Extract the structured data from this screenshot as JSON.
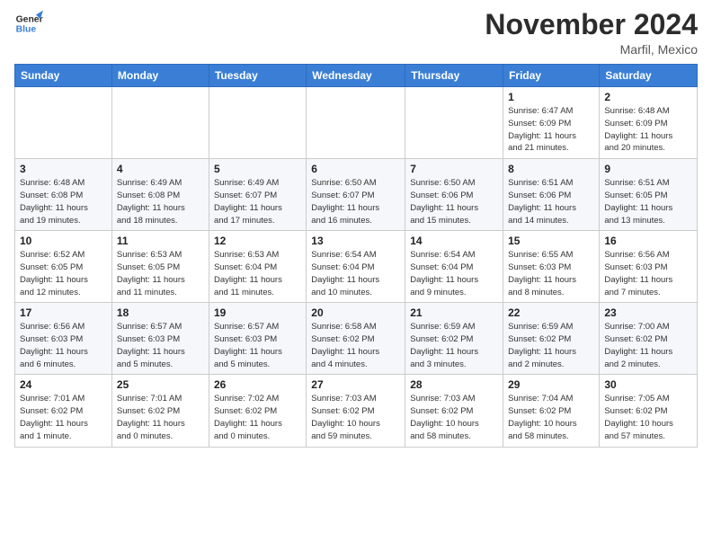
{
  "logo": {
    "line1": "General",
    "line2": "Blue"
  },
  "title": "November 2024",
  "location": "Marfil, Mexico",
  "days_of_week": [
    "Sunday",
    "Monday",
    "Tuesday",
    "Wednesday",
    "Thursday",
    "Friday",
    "Saturday"
  ],
  "weeks": [
    [
      {
        "day": "",
        "info": ""
      },
      {
        "day": "",
        "info": ""
      },
      {
        "day": "",
        "info": ""
      },
      {
        "day": "",
        "info": ""
      },
      {
        "day": "",
        "info": ""
      },
      {
        "day": "1",
        "info": "Sunrise: 6:47 AM\nSunset: 6:09 PM\nDaylight: 11 hours\nand 21 minutes."
      },
      {
        "day": "2",
        "info": "Sunrise: 6:48 AM\nSunset: 6:09 PM\nDaylight: 11 hours\nand 20 minutes."
      }
    ],
    [
      {
        "day": "3",
        "info": "Sunrise: 6:48 AM\nSunset: 6:08 PM\nDaylight: 11 hours\nand 19 minutes."
      },
      {
        "day": "4",
        "info": "Sunrise: 6:49 AM\nSunset: 6:08 PM\nDaylight: 11 hours\nand 18 minutes."
      },
      {
        "day": "5",
        "info": "Sunrise: 6:49 AM\nSunset: 6:07 PM\nDaylight: 11 hours\nand 17 minutes."
      },
      {
        "day": "6",
        "info": "Sunrise: 6:50 AM\nSunset: 6:07 PM\nDaylight: 11 hours\nand 16 minutes."
      },
      {
        "day": "7",
        "info": "Sunrise: 6:50 AM\nSunset: 6:06 PM\nDaylight: 11 hours\nand 15 minutes."
      },
      {
        "day": "8",
        "info": "Sunrise: 6:51 AM\nSunset: 6:06 PM\nDaylight: 11 hours\nand 14 minutes."
      },
      {
        "day": "9",
        "info": "Sunrise: 6:51 AM\nSunset: 6:05 PM\nDaylight: 11 hours\nand 13 minutes."
      }
    ],
    [
      {
        "day": "10",
        "info": "Sunrise: 6:52 AM\nSunset: 6:05 PM\nDaylight: 11 hours\nand 12 minutes."
      },
      {
        "day": "11",
        "info": "Sunrise: 6:53 AM\nSunset: 6:05 PM\nDaylight: 11 hours\nand 11 minutes."
      },
      {
        "day": "12",
        "info": "Sunrise: 6:53 AM\nSunset: 6:04 PM\nDaylight: 11 hours\nand 11 minutes."
      },
      {
        "day": "13",
        "info": "Sunrise: 6:54 AM\nSunset: 6:04 PM\nDaylight: 11 hours\nand 10 minutes."
      },
      {
        "day": "14",
        "info": "Sunrise: 6:54 AM\nSunset: 6:04 PM\nDaylight: 11 hours\nand 9 minutes."
      },
      {
        "day": "15",
        "info": "Sunrise: 6:55 AM\nSunset: 6:03 PM\nDaylight: 11 hours\nand 8 minutes."
      },
      {
        "day": "16",
        "info": "Sunrise: 6:56 AM\nSunset: 6:03 PM\nDaylight: 11 hours\nand 7 minutes."
      }
    ],
    [
      {
        "day": "17",
        "info": "Sunrise: 6:56 AM\nSunset: 6:03 PM\nDaylight: 11 hours\nand 6 minutes."
      },
      {
        "day": "18",
        "info": "Sunrise: 6:57 AM\nSunset: 6:03 PM\nDaylight: 11 hours\nand 5 minutes."
      },
      {
        "day": "19",
        "info": "Sunrise: 6:57 AM\nSunset: 6:03 PM\nDaylight: 11 hours\nand 5 minutes."
      },
      {
        "day": "20",
        "info": "Sunrise: 6:58 AM\nSunset: 6:02 PM\nDaylight: 11 hours\nand 4 minutes."
      },
      {
        "day": "21",
        "info": "Sunrise: 6:59 AM\nSunset: 6:02 PM\nDaylight: 11 hours\nand 3 minutes."
      },
      {
        "day": "22",
        "info": "Sunrise: 6:59 AM\nSunset: 6:02 PM\nDaylight: 11 hours\nand 2 minutes."
      },
      {
        "day": "23",
        "info": "Sunrise: 7:00 AM\nSunset: 6:02 PM\nDaylight: 11 hours\nand 2 minutes."
      }
    ],
    [
      {
        "day": "24",
        "info": "Sunrise: 7:01 AM\nSunset: 6:02 PM\nDaylight: 11 hours\nand 1 minute."
      },
      {
        "day": "25",
        "info": "Sunrise: 7:01 AM\nSunset: 6:02 PM\nDaylight: 11 hours\nand 0 minutes."
      },
      {
        "day": "26",
        "info": "Sunrise: 7:02 AM\nSunset: 6:02 PM\nDaylight: 11 hours\nand 0 minutes."
      },
      {
        "day": "27",
        "info": "Sunrise: 7:03 AM\nSunset: 6:02 PM\nDaylight: 10 hours\nand 59 minutes."
      },
      {
        "day": "28",
        "info": "Sunrise: 7:03 AM\nSunset: 6:02 PM\nDaylight: 10 hours\nand 58 minutes."
      },
      {
        "day": "29",
        "info": "Sunrise: 7:04 AM\nSunset: 6:02 PM\nDaylight: 10 hours\nand 58 minutes."
      },
      {
        "day": "30",
        "info": "Sunrise: 7:05 AM\nSunset: 6:02 PM\nDaylight: 10 hours\nand 57 minutes."
      }
    ]
  ]
}
